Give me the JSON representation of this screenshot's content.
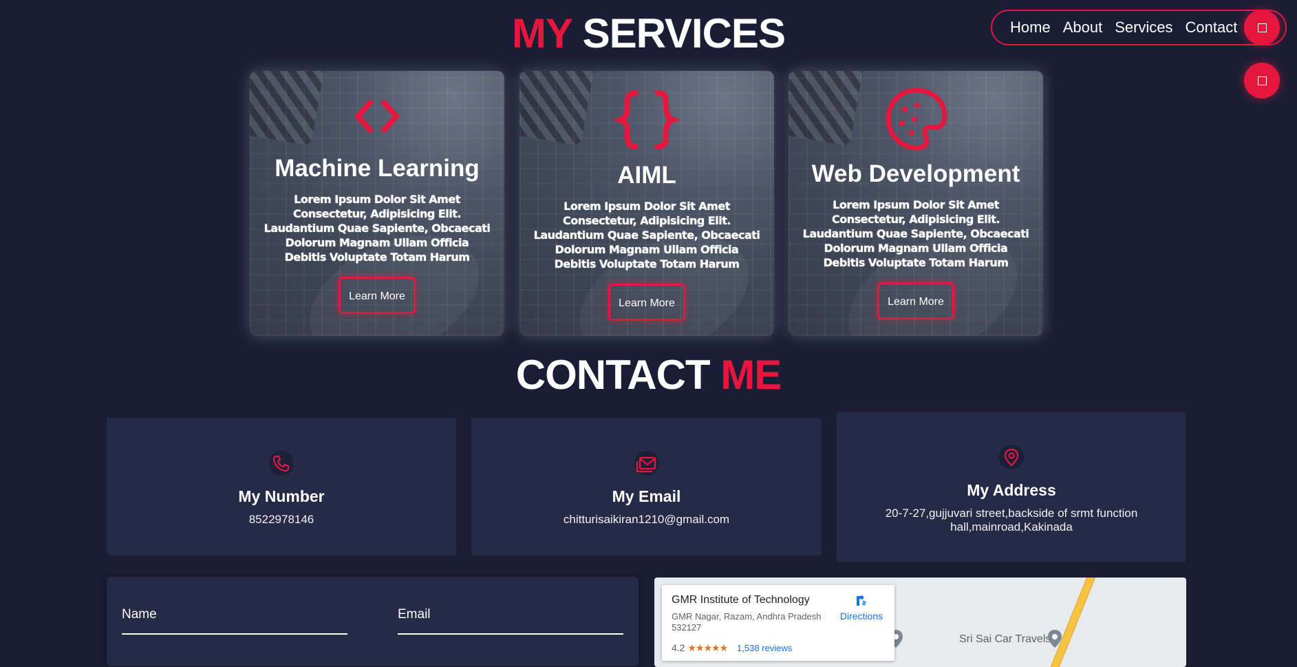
{
  "services": {
    "title_accent": "MY",
    "title_rest": "SERVICES",
    "cards": [
      {
        "icon": "code-brackets-icon",
        "title": "Machine Learning",
        "text": "Lorem Ipsum Dolor Sit Amet Consectetur, Adipisicing Elit. Laudantium Quae Sapiente, Obcaecati Dolorum Magnam Ullam Officia Debitis Voluptate Totam Harum",
        "button": "Learn More"
      },
      {
        "icon": "curly-braces-icon",
        "title": "AIML",
        "text": "Lorem Ipsum Dolor Sit Amet Consectetur, Adipisicing Elit. Laudantium Quae Sapiente, Obcaecati Dolorum Magnam Ullam Officia Debitis Voluptate Totam Harum",
        "button": "Learn More"
      },
      {
        "icon": "cookie-icon",
        "title": "Web Development",
        "text": "Lorem Ipsum Dolor Sit Amet Consectetur, Adipisicing Elit. Laudantium Quae Sapiente, Obcaecati Dolorum Magnam Ullam Officia Debitis Voluptate Totam Harum",
        "button": "Learn More"
      }
    ]
  },
  "nav": {
    "items": [
      "Home",
      "About",
      "Services",
      "Contact"
    ]
  },
  "contact": {
    "title_rest": "CONTACT",
    "title_accent": "ME",
    "boxes": [
      {
        "icon": "phone-icon",
        "title": "My Number",
        "value": "8522978146"
      },
      {
        "icon": "email-icon",
        "title": "My Email",
        "value": "chitturisaikiran1210@gmail.com"
      },
      {
        "icon": "location-pin-icon",
        "title": "My Address",
        "value": "20-7-27,gujjuvari street,backside of srmt function hall,mainroad,Kakinada"
      }
    ],
    "form": {
      "name_placeholder": "Name",
      "email_placeholder": "Email"
    }
  },
  "map": {
    "place_name": "GMR Institute of Technology",
    "address": "GMR Nagar, Razam, Andhra Pradesh 532127",
    "rating": "4.2",
    "stars": "★★★★★",
    "reviews": "1,538 reviews",
    "directions": "Directions",
    "nearby_label": "Sri Sai Car Travels"
  },
  "colors": {
    "accent": "#e5173f",
    "background": "#191e35",
    "panel": "#252b47"
  }
}
